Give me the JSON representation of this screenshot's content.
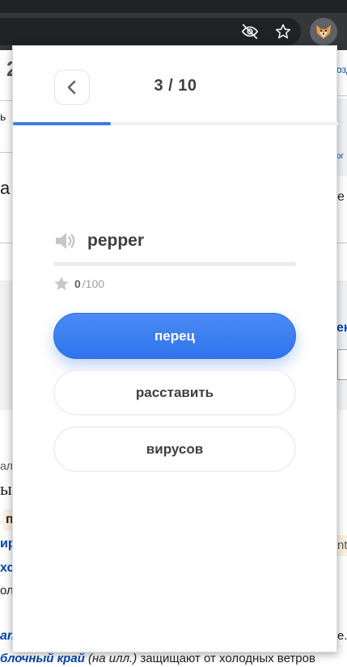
{
  "browser": {
    "icons": [
      "eye-off-icon",
      "star-icon",
      "extension-fox-icon"
    ]
  },
  "background_page": {
    "fragments": {
      "f1": "2",
      "f2": "ь",
      "f3": "озд",
      "f4": "ог",
      "f5": "а",
      "f6": "е",
      "f7": "ен",
      "f8": "ал",
      "f9": "ы",
      "f10": "п",
      "f11": "ир",
      "f12": "nt",
      "f13": "хс",
      "f14": "олу",
      "f15": "ат",
      "f16": "е.",
      "bottom_link": "блочный край",
      "bottom_italic": "(на илл.)",
      "bottom_rest": "защищают от холодных ветров"
    }
  },
  "popup": {
    "progress": {
      "label": "3 / 10",
      "current": 3,
      "total": 10
    },
    "word": {
      "text": "pepper",
      "icon": "speaker-icon"
    },
    "score": {
      "value": "0",
      "total": "/100",
      "icon": "star-icon"
    },
    "answers": [
      {
        "label": "перец",
        "selected": true
      },
      {
        "label": "расставить",
        "selected": false
      },
      {
        "label": "вирусов",
        "selected": false
      }
    ],
    "colors": {
      "accent": "#3e7be6",
      "text": "#3c4043"
    }
  }
}
